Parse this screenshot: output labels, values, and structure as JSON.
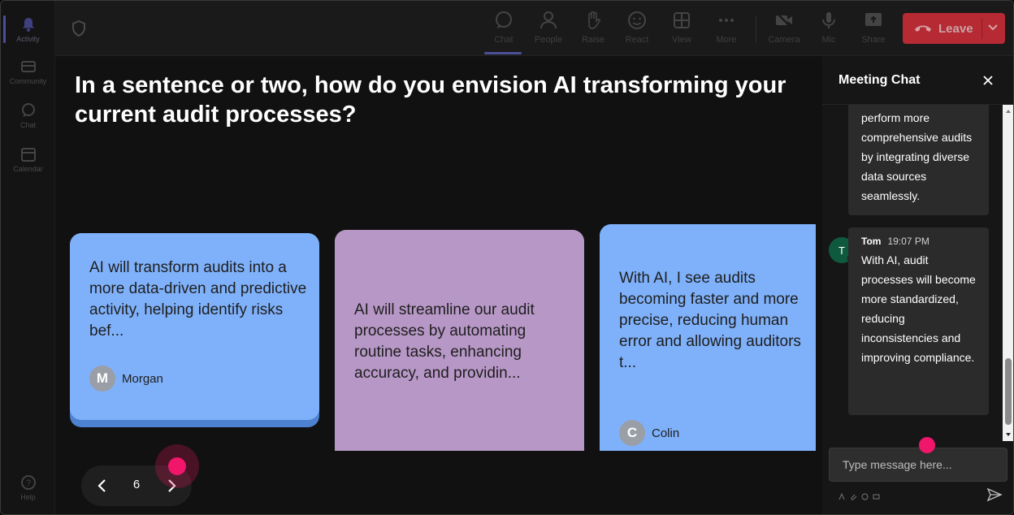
{
  "rail": {
    "items": [
      {
        "label": "Activity"
      },
      {
        "label": "Community"
      },
      {
        "label": "Chat"
      },
      {
        "label": "Calendar"
      }
    ],
    "help": "Help"
  },
  "toolbar": {
    "chat": "Chat",
    "people": "People",
    "raise": "Raise",
    "react": "React",
    "view": "View",
    "more": "More",
    "camera": "Camera",
    "mic": "Mic",
    "share": "Share",
    "leave": "Leave"
  },
  "question": "In a sentence or two, how do you envision AI transforming your current audit processes?",
  "cards": [
    {
      "text": "AI will transform audits into a more data-driven and predictive activity, helping identify risks bef...",
      "author": "Morgan",
      "initial": "M",
      "color": "#7fb1fa"
    },
    {
      "text": "AI will streamline our audit processes by automating routine tasks, enhancing accuracy, and providin...",
      "color": "#b797c6"
    },
    {
      "text": "With AI, I see audits becoming faster and more precise, reducing human error and allowing auditors t...",
      "author": "Colin",
      "initial": "C",
      "color": "#7fb1fa"
    }
  ],
  "pager": {
    "page": "6"
  },
  "chat": {
    "title": "Meeting Chat",
    "messages": [
      {
        "text": "perform more comprehensive audits by integrating diverse data sources seamlessly."
      },
      {
        "sender": "Tom",
        "initial": "T",
        "time": "19:07 PM",
        "text": "With AI, audit processes will become more standardized, reducing inconsistencies and improving compliance."
      }
    ],
    "input_placeholder": "Type message here..."
  },
  "colors": {
    "leave": "#b52a33",
    "accent": "#4c4f96",
    "click_marker": "#f0166a"
  }
}
